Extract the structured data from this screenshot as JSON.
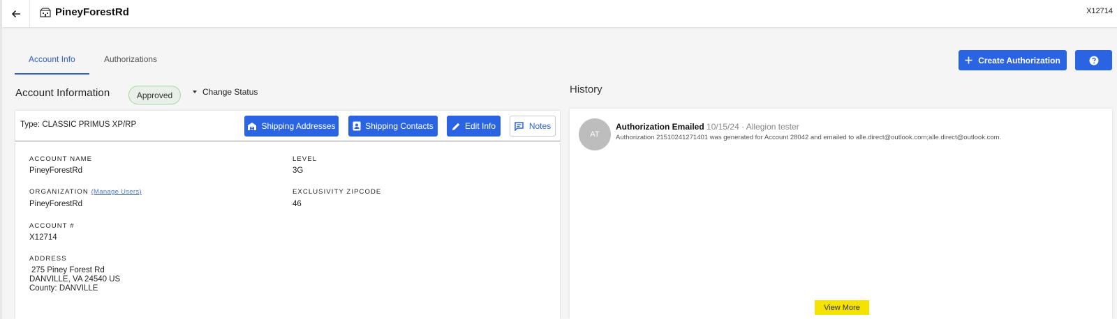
{
  "header": {
    "title": "PineyForestRd",
    "account_id": "X12714"
  },
  "tabs": [
    {
      "label": "Account Info",
      "active": true
    },
    {
      "label": "Authorizations",
      "active": false
    }
  ],
  "actions": {
    "create_authorization": "Create Authorization"
  },
  "account_section": {
    "title": "Account Information",
    "status": "Approved",
    "change_status": "Change Status"
  },
  "card": {
    "type_label": "Type: CLASSIC PRIMUS XP/RP",
    "buttons": {
      "shipping_addresses": "Shipping Addresses",
      "shipping_contacts": "Shipping Contacts",
      "edit_info": "Edit Info",
      "notes": "Notes"
    },
    "fields": {
      "account_name": {
        "label": "ACCOUNT NAME",
        "value": "PineyForestRd"
      },
      "organization": {
        "label": "ORGANIZATION",
        "link": "(Manage Users)",
        "value": "PineyForestRd"
      },
      "account_number": {
        "label": "ACCOUNT #",
        "value": "X12714"
      },
      "address": {
        "label": "ADDRESS",
        "line1": "275 Piney Forest Rd",
        "line2": "DANVILLE, VA 24540 US",
        "line3": "County: DANVILLE"
      },
      "level": {
        "label": "LEVEL",
        "value": "3G"
      },
      "exclusivity_zipcode": {
        "label": "EXCLUSIVITY ZIPCODE",
        "value": "46"
      }
    }
  },
  "history": {
    "title": "History",
    "entries": [
      {
        "avatar": "AT",
        "title": "Authorization Emailed",
        "meta": "10/15/24 · Allegion tester",
        "description": "Authorization 21510241271401 was generated for Account 28042 and emailed to alle.direct@outlook.com;alle.direct@outlook.com."
      }
    ],
    "view_more": "View More"
  },
  "colors": {
    "primary": "#2b64e3",
    "tab_active": "#2f5fd0",
    "status_border": "#a6d6a6",
    "view_more_bg": "#f6e200"
  }
}
